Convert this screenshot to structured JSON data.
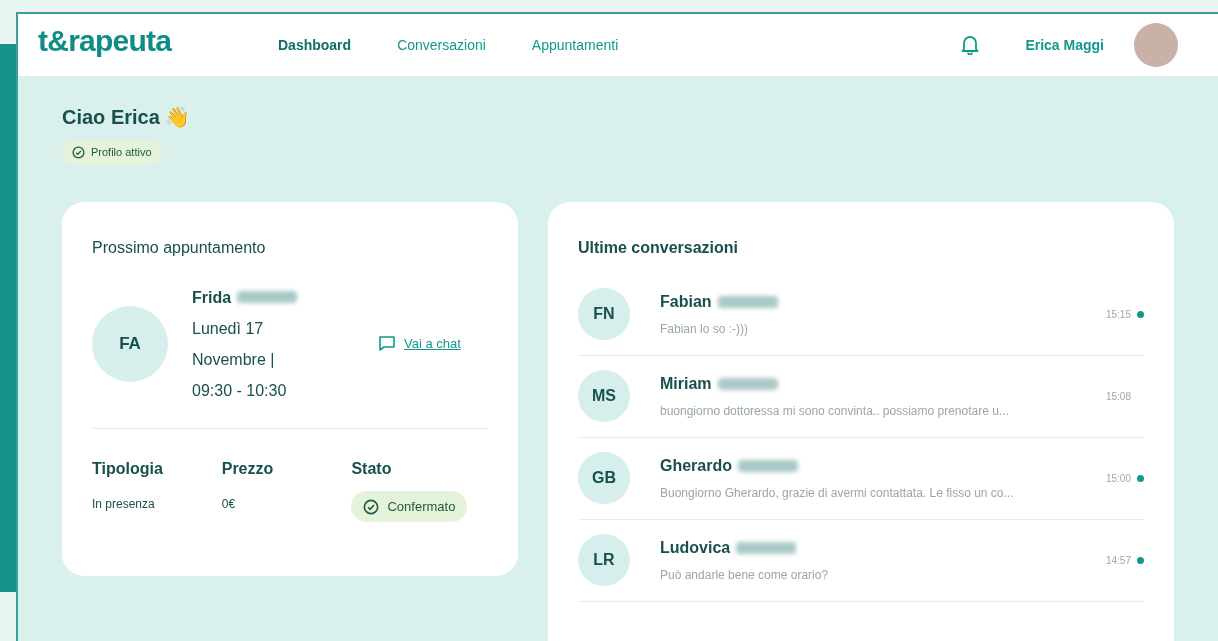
{
  "header": {
    "logo": "t&rapeuta",
    "nav": [
      {
        "label": "Dashboard",
        "selected": true
      },
      {
        "label": "Conversazioni",
        "selected": false
      },
      {
        "label": "Appuntamenti",
        "selected": false
      }
    ],
    "user_name": "Erica Maggi"
  },
  "greeting": {
    "title": "Ciao Erica 👋",
    "badge": "Profilo attivo"
  },
  "appointment": {
    "title": "Prossimo appuntamento",
    "initials": "FA",
    "first_name": "Frida",
    "date_lines": [
      "Lunedì 17",
      "Novembre |",
      "09:30 - 10:30"
    ],
    "chat_link": "Vai a chat",
    "details": [
      {
        "label": "Tipologia",
        "value": "In presenza",
        "kind": "text"
      },
      {
        "label": "Prezzo",
        "value": "0€",
        "kind": "text"
      },
      {
        "label": "Stato",
        "value": "Confermato",
        "kind": "badge"
      }
    ]
  },
  "conversations": {
    "title": "Ultime conversazioni",
    "items": [
      {
        "initials": "FN",
        "first_name": "Fabian",
        "message": "Fabian lo so :-)))",
        "time": "15:15",
        "unread": true
      },
      {
        "initials": "MS",
        "first_name": "Miriam",
        "message": "buongiorno dottoressa mi sono convinta.. possiamo prenotare u...",
        "time": "15:08",
        "unread": false
      },
      {
        "initials": "GB",
        "first_name": "Gherardo",
        "message": "Buongiorno Gherardo, grazie di avermi contattata. Le fisso un co...",
        "time": "15:00",
        "unread": true
      },
      {
        "initials": "LR",
        "first_name": "Ludovica",
        "message": "Può andarle bene come orario?",
        "time": "14:57",
        "unread": true
      }
    ]
  }
}
